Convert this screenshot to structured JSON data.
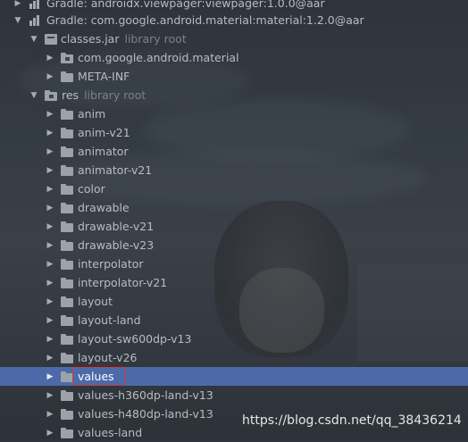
{
  "tree": {
    "rows": [
      {
        "label": "Gradle: androidx.viewpager:viewpager:1.0.0@aar",
        "hint": "",
        "icon": "library-icon",
        "expanded": false
      },
      {
        "label": "Gradle: com.google.android.material:material:1.2.0@aar",
        "hint": "",
        "icon": "library-icon",
        "expanded": true
      },
      {
        "label": "classes.jar",
        "hint": "library root",
        "icon": "jar-icon",
        "expanded": true
      },
      {
        "label": "com.google.android.material",
        "hint": "",
        "icon": "package-folder-icon",
        "expanded": false
      },
      {
        "label": "META-INF",
        "hint": "",
        "icon": "folder-icon",
        "expanded": false
      },
      {
        "label": "res",
        "hint": "library root",
        "icon": "folder-icon",
        "expanded": true
      },
      {
        "label": "anim",
        "hint": "",
        "icon": "folder-icon",
        "expanded": false
      },
      {
        "label": "anim-v21",
        "hint": "",
        "icon": "folder-icon",
        "expanded": false
      },
      {
        "label": "animator",
        "hint": "",
        "icon": "folder-icon",
        "expanded": false
      },
      {
        "label": "animator-v21",
        "hint": "",
        "icon": "folder-icon",
        "expanded": false
      },
      {
        "label": "color",
        "hint": "",
        "icon": "folder-icon",
        "expanded": false
      },
      {
        "label": "drawable",
        "hint": "",
        "icon": "folder-icon",
        "expanded": false
      },
      {
        "label": "drawable-v21",
        "hint": "",
        "icon": "folder-icon",
        "expanded": false
      },
      {
        "label": "drawable-v23",
        "hint": "",
        "icon": "folder-icon",
        "expanded": false
      },
      {
        "label": "interpolator",
        "hint": "",
        "icon": "folder-icon",
        "expanded": false
      },
      {
        "label": "interpolator-v21",
        "hint": "",
        "icon": "folder-icon",
        "expanded": false
      },
      {
        "label": "layout",
        "hint": "",
        "icon": "folder-icon",
        "expanded": false
      },
      {
        "label": "layout-land",
        "hint": "",
        "icon": "folder-icon",
        "expanded": false
      },
      {
        "label": "layout-sw600dp-v13",
        "hint": "",
        "icon": "folder-icon",
        "expanded": false
      },
      {
        "label": "layout-v26",
        "hint": "",
        "icon": "folder-icon",
        "expanded": false
      },
      {
        "label": "values",
        "hint": "",
        "icon": "folder-icon",
        "expanded": false,
        "selected": true
      },
      {
        "label": "values-h360dp-land-v13",
        "hint": "",
        "icon": "folder-icon",
        "expanded": false
      },
      {
        "label": "values-h480dp-land-v13",
        "hint": "",
        "icon": "folder-icon",
        "expanded": false
      },
      {
        "label": "values-land",
        "hint": "",
        "icon": "folder-icon",
        "expanded": false
      }
    ]
  },
  "watermark": "https://blog.csdn.net/qq_38436214",
  "colors": {
    "background": "#2f353c",
    "selection": "#4c6aa8",
    "highlight_box": "#d23b3b",
    "text": "#b9bcbf",
    "hint_text": "#7d8184"
  }
}
